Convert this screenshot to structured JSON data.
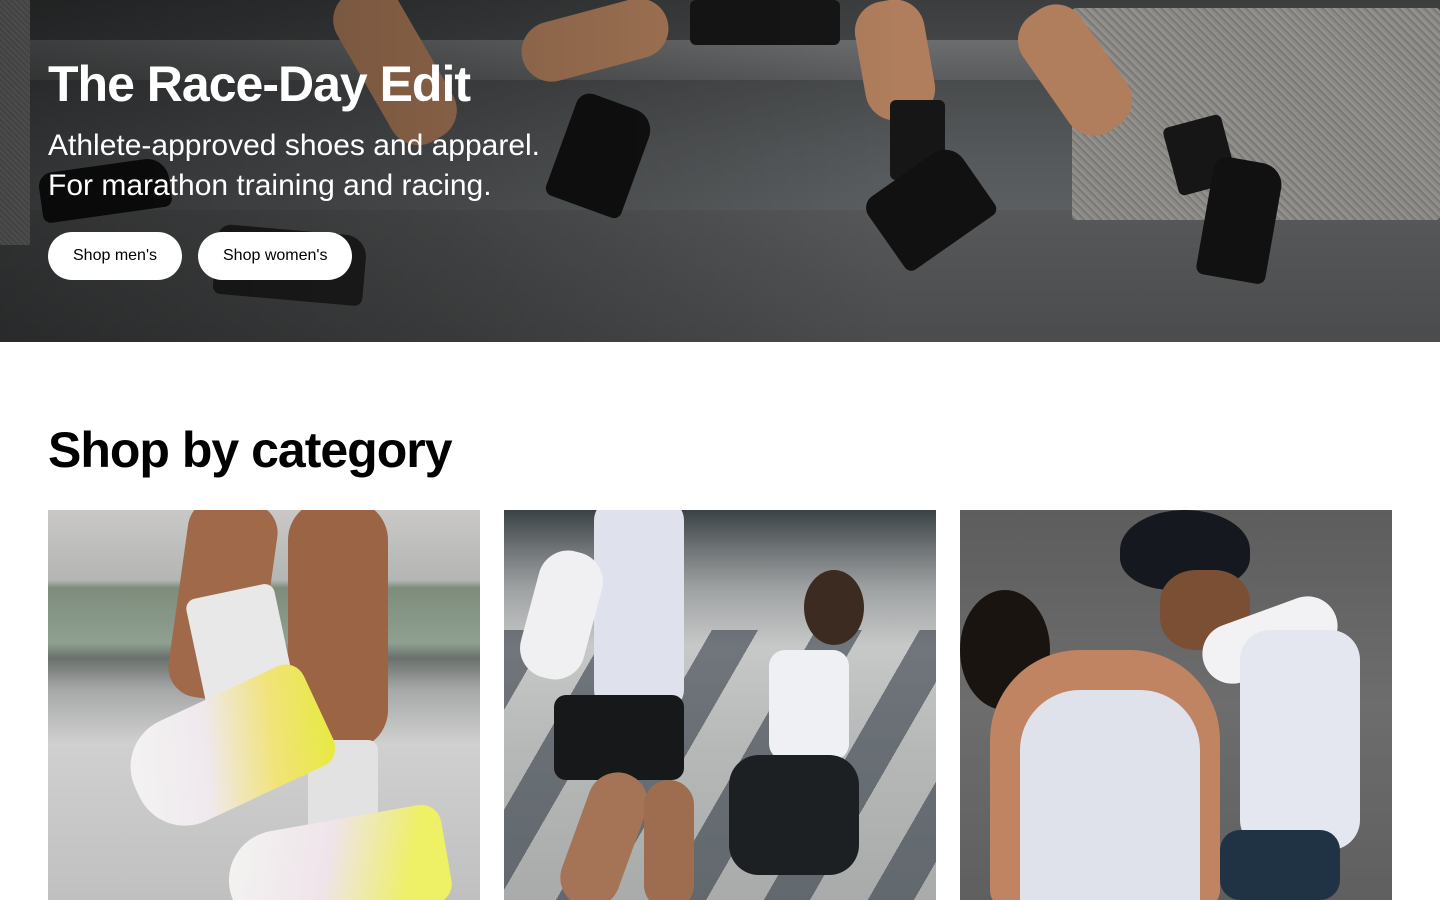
{
  "hero": {
    "title": "The Race-Day Edit",
    "subtitle_line1": "Athlete-approved shoes and apparel.",
    "subtitle_line2": "For marathon training and racing.",
    "buttons": [
      {
        "label": "Shop men's"
      },
      {
        "label": "Shop women's"
      }
    ]
  },
  "category": {
    "heading": "Shop by category",
    "cards": [
      {
        "image": "running-shoes-photo"
      },
      {
        "image": "runners-photo"
      },
      {
        "image": "athletes-embrace-photo"
      }
    ]
  },
  "colors": {
    "button_bg": "#ffffff",
    "text_dark": "#000000",
    "text_light": "#ffffff"
  }
}
